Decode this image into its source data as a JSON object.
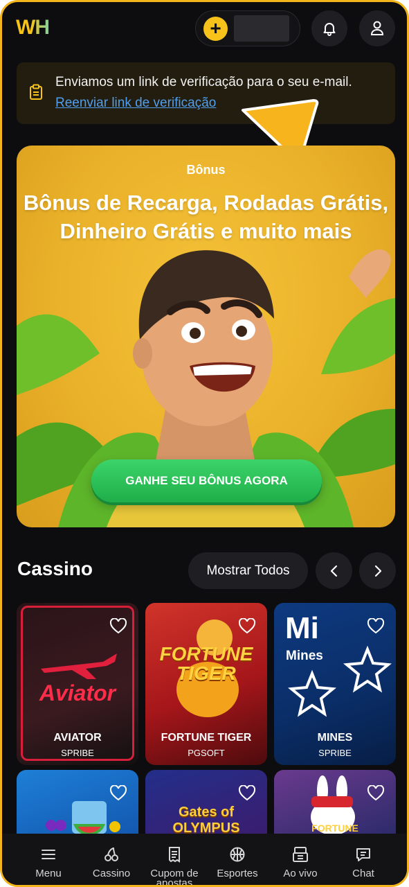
{
  "header": {
    "logo": "WH",
    "add_funds_icon": "plus-icon",
    "notifications_icon": "bell-icon",
    "profile_icon": "user-icon"
  },
  "verification_banner": {
    "icon": "clipboard-icon",
    "message": "Enviamos um link de verificação para o seu e-mail.",
    "link": "Reenviar link de verificação"
  },
  "hero": {
    "label": "Bônus",
    "title_line1": "Bônus de Recarga, Rodadas Grátis,",
    "title_line2": "Dinheiro Grátis e muito mais",
    "cta": "GANHE SEU BÔNUS AGORA"
  },
  "casino": {
    "title": "Cassino",
    "show_all": "Mostrar Todos",
    "games": [
      {
        "name": "AVIATOR",
        "provider": "SPRIBE",
        "art_text": "Aviator"
      },
      {
        "name": "FORTUNE TIGER",
        "provider": "PGSOFT",
        "art_text": "FORTUNE TIGER"
      },
      {
        "name": "MINES",
        "provider": "SPRIBE",
        "art_text": "Mi",
        "art_sub": "Mines"
      },
      {
        "name": "",
        "provider": ""
      },
      {
        "name": "",
        "provider": "",
        "art_text": "Gates of OLYMPUS"
      },
      {
        "name": "",
        "provider": "",
        "art_text": "FORTUNE"
      }
    ]
  },
  "bottom_nav": [
    {
      "label": "Menu",
      "icon": "menu-icon"
    },
    {
      "label": "Cassino",
      "icon": "cherries-icon"
    },
    {
      "label": "Cupom de apostas",
      "icon": "receipt-icon"
    },
    {
      "label": "Esportes",
      "icon": "basketball-icon"
    },
    {
      "label": "Ao vivo",
      "icon": "live-icon"
    },
    {
      "label": "Chat",
      "icon": "chat-icon"
    }
  ],
  "colors": {
    "accent": "#f7c21a",
    "background": "#0d0d0f",
    "cta_green": "#2cc35a",
    "link_blue": "#4f9ff0"
  }
}
